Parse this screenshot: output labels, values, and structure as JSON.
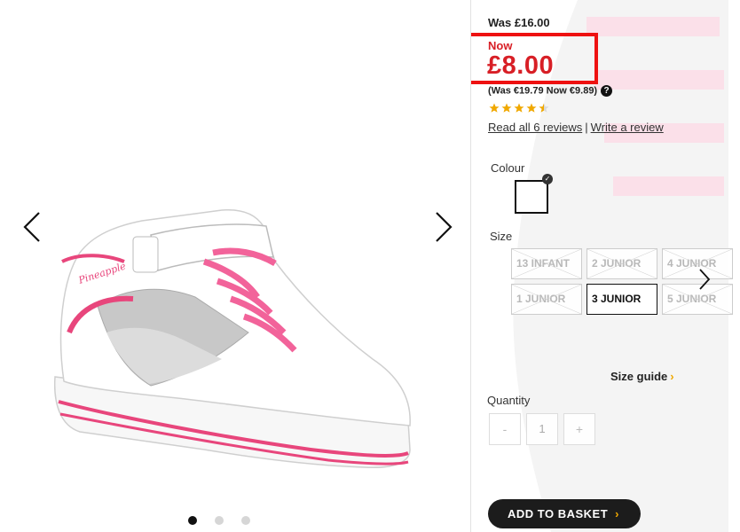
{
  "gallery": {
    "dots_count": 3,
    "active_dot": 0,
    "brand_on_shoe": "Pineapple"
  },
  "price": {
    "was": "Was £16.00",
    "now_label": "Now",
    "now": "£8.00",
    "euro": "(Was €19.79 Now €9.89)",
    "help_icon": "?"
  },
  "rating": {
    "stars": 4.5,
    "max": 5
  },
  "reviews": {
    "read_all": "Read all 6 reviews",
    "separator": "|",
    "write": "Write a review"
  },
  "colour": {
    "label": "Colour",
    "selected_swatch": "#ffffff",
    "check": "✓"
  },
  "size": {
    "label": "Size",
    "options": [
      {
        "label": "13 INFANT",
        "state": "unavailable"
      },
      {
        "label": "2 JUNIOR",
        "state": "unavailable"
      },
      {
        "label": "4 JUNIOR",
        "state": "unavailable"
      },
      {
        "label": "1 JUNIOR",
        "state": "unavailable"
      },
      {
        "label": "3 JUNIOR",
        "state": "selected"
      },
      {
        "label": "5 JUNIOR",
        "state": "unavailable"
      }
    ],
    "guide": "Size guide",
    "guide_chev": "›"
  },
  "quantity": {
    "label": "Quantity",
    "minus": "-",
    "value": "1",
    "plus": "+"
  },
  "basket": {
    "label": "ADD TO BASKET",
    "chev": "›"
  },
  "colors": {
    "price_red": "#d81f26",
    "highlight": "#ee1111",
    "star": "#f0a800",
    "button_bg": "#1c1c1c"
  }
}
